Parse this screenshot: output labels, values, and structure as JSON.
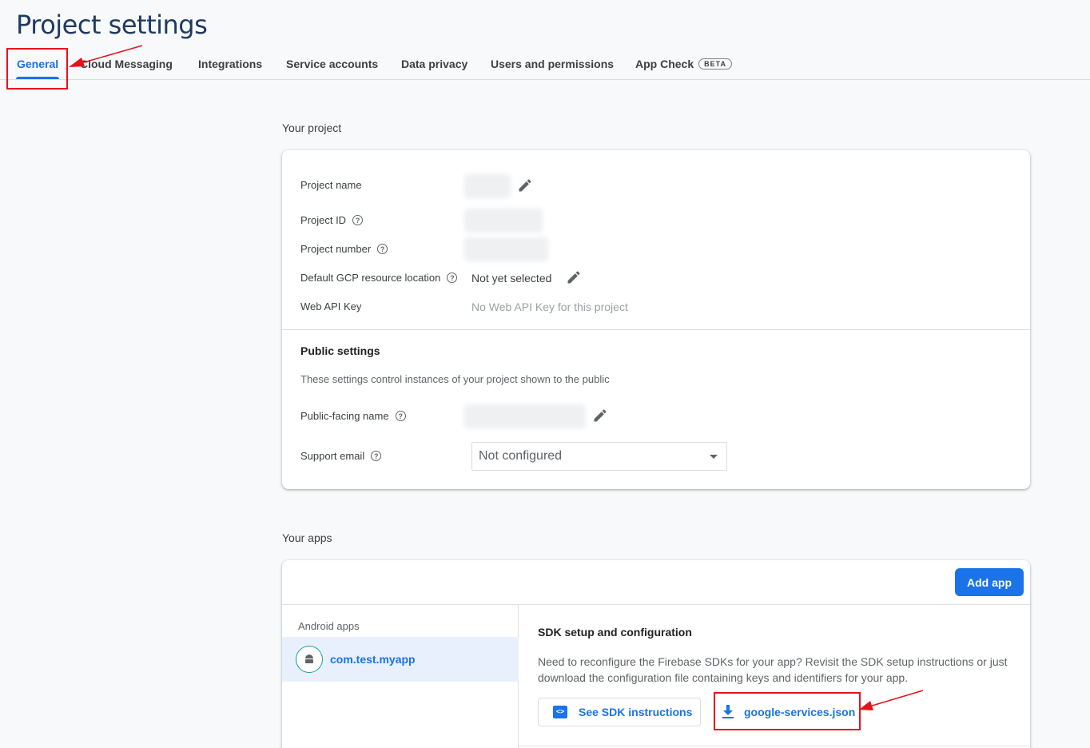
{
  "header": {
    "title": "Project settings"
  },
  "tabs": [
    {
      "label": "General",
      "active": true
    },
    {
      "label": "Cloud Messaging"
    },
    {
      "label": "Integrations"
    },
    {
      "label": "Service accounts"
    },
    {
      "label": "Data privacy"
    },
    {
      "label": "Users and permissions"
    },
    {
      "label": "App Check",
      "badge": "BETA"
    }
  ],
  "your_project": {
    "heading": "Your project",
    "rows": {
      "project_name": {
        "label": "Project name"
      },
      "project_id": {
        "label": "Project ID"
      },
      "project_number": {
        "label": "Project number"
      },
      "gcp_location": {
        "label": "Default GCP resource location",
        "value": "Not yet selected"
      },
      "web_api_key": {
        "label": "Web API Key",
        "value": "No Web API Key for this project"
      }
    },
    "public_settings": {
      "title": "Public settings",
      "description": "These settings control instances of your project shown to the public",
      "public_facing_name_label": "Public-facing name",
      "support_email_label": "Support email",
      "support_email_value": "Not configured"
    }
  },
  "your_apps": {
    "heading": "Your apps",
    "add_app_label": "Add app",
    "android_heading": "Android apps",
    "app_name": "com.test.myapp",
    "sdk_title": "SDK setup and configuration",
    "sdk_description": "Need to reconfigure the Firebase SDKs for your app? Revisit the SDK setup instructions or just download the configuration file containing keys and identifiers for your app.",
    "sdk_button_label": "See SDK instructions",
    "download_button_label": "google-services.json"
  },
  "colors": {
    "accent": "#1a73e8",
    "annotation": "#e8111a",
    "title": "#1f3a5f"
  },
  "icons": [
    "edit-icon",
    "help-icon",
    "chevron-down-icon",
    "android-icon",
    "code-icon",
    "download-icon"
  ]
}
